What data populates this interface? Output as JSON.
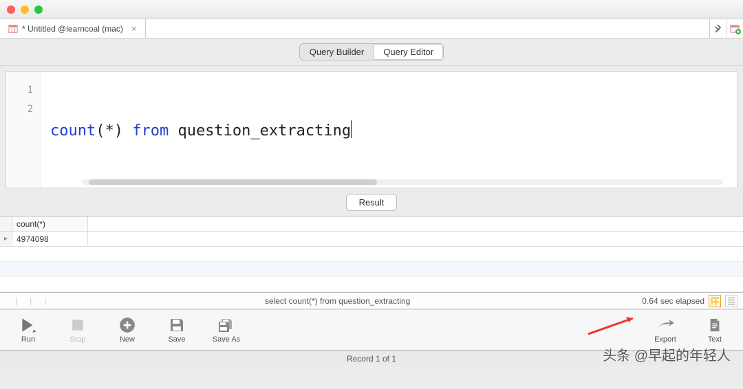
{
  "window": {
    "tab_title": "* Untitled @learncoal (mac)"
  },
  "segmented": {
    "builder": "Query Builder",
    "editor": "Query Editor"
  },
  "editor": {
    "lines": [
      "1",
      "2"
    ],
    "code_kw1": "count",
    "code_p1": "(*) ",
    "code_kw2": "from",
    "code_p2": " question_extracting"
  },
  "result": {
    "tab": "Result",
    "header": "count(*)",
    "value": "4974098"
  },
  "infobar": {
    "query": "select count(*) from question_extracting",
    "elapsed": "0.64 sec elapsed"
  },
  "toolbar": {
    "run": "Run",
    "stop": "Stop",
    "new": "New",
    "save": "Save",
    "saveas": "Save As",
    "export": "Export",
    "text": "Text"
  },
  "statusbar": {
    "record": "Record 1 of 1"
  },
  "watermark": "头条 @早起的年轻人"
}
